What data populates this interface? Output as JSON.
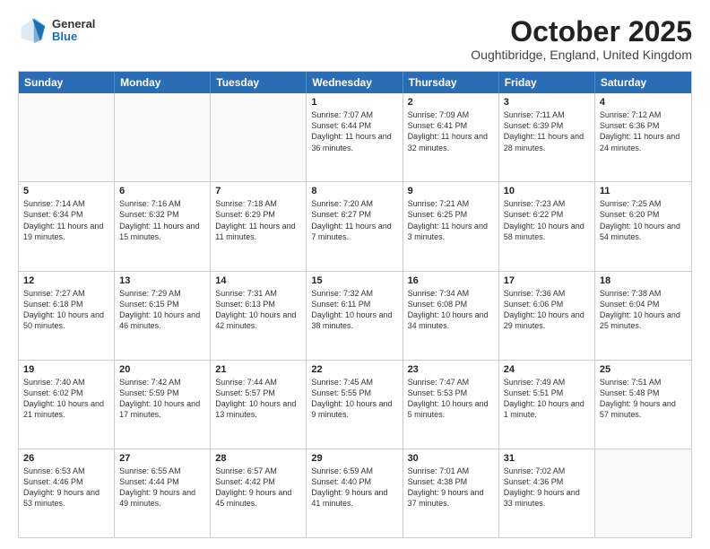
{
  "header": {
    "logo_general": "General",
    "logo_blue": "Blue",
    "month_year": "October 2025",
    "location": "Oughtibridge, England, United Kingdom"
  },
  "days_of_week": [
    "Sunday",
    "Monday",
    "Tuesday",
    "Wednesday",
    "Thursday",
    "Friday",
    "Saturday"
  ],
  "rows": [
    [
      {
        "day": "",
        "sunrise": "",
        "sunset": "",
        "daylight": ""
      },
      {
        "day": "",
        "sunrise": "",
        "sunset": "",
        "daylight": ""
      },
      {
        "day": "",
        "sunrise": "",
        "sunset": "",
        "daylight": ""
      },
      {
        "day": "1",
        "sunrise": "Sunrise: 7:07 AM",
        "sunset": "Sunset: 6:44 PM",
        "daylight": "Daylight: 11 hours and 36 minutes."
      },
      {
        "day": "2",
        "sunrise": "Sunrise: 7:09 AM",
        "sunset": "Sunset: 6:41 PM",
        "daylight": "Daylight: 11 hours and 32 minutes."
      },
      {
        "day": "3",
        "sunrise": "Sunrise: 7:11 AM",
        "sunset": "Sunset: 6:39 PM",
        "daylight": "Daylight: 11 hours and 28 minutes."
      },
      {
        "day": "4",
        "sunrise": "Sunrise: 7:12 AM",
        "sunset": "Sunset: 6:36 PM",
        "daylight": "Daylight: 11 hours and 24 minutes."
      }
    ],
    [
      {
        "day": "5",
        "sunrise": "Sunrise: 7:14 AM",
        "sunset": "Sunset: 6:34 PM",
        "daylight": "Daylight: 11 hours and 19 minutes."
      },
      {
        "day": "6",
        "sunrise": "Sunrise: 7:16 AM",
        "sunset": "Sunset: 6:32 PM",
        "daylight": "Daylight: 11 hours and 15 minutes."
      },
      {
        "day": "7",
        "sunrise": "Sunrise: 7:18 AM",
        "sunset": "Sunset: 6:29 PM",
        "daylight": "Daylight: 11 hours and 11 minutes."
      },
      {
        "day": "8",
        "sunrise": "Sunrise: 7:20 AM",
        "sunset": "Sunset: 6:27 PM",
        "daylight": "Daylight: 11 hours and 7 minutes."
      },
      {
        "day": "9",
        "sunrise": "Sunrise: 7:21 AM",
        "sunset": "Sunset: 6:25 PM",
        "daylight": "Daylight: 11 hours and 3 minutes."
      },
      {
        "day": "10",
        "sunrise": "Sunrise: 7:23 AM",
        "sunset": "Sunset: 6:22 PM",
        "daylight": "Daylight: 10 hours and 58 minutes."
      },
      {
        "day": "11",
        "sunrise": "Sunrise: 7:25 AM",
        "sunset": "Sunset: 6:20 PM",
        "daylight": "Daylight: 10 hours and 54 minutes."
      }
    ],
    [
      {
        "day": "12",
        "sunrise": "Sunrise: 7:27 AM",
        "sunset": "Sunset: 6:18 PM",
        "daylight": "Daylight: 10 hours and 50 minutes."
      },
      {
        "day": "13",
        "sunrise": "Sunrise: 7:29 AM",
        "sunset": "Sunset: 6:15 PM",
        "daylight": "Daylight: 10 hours and 46 minutes."
      },
      {
        "day": "14",
        "sunrise": "Sunrise: 7:31 AM",
        "sunset": "Sunset: 6:13 PM",
        "daylight": "Daylight: 10 hours and 42 minutes."
      },
      {
        "day": "15",
        "sunrise": "Sunrise: 7:32 AM",
        "sunset": "Sunset: 6:11 PM",
        "daylight": "Daylight: 10 hours and 38 minutes."
      },
      {
        "day": "16",
        "sunrise": "Sunrise: 7:34 AM",
        "sunset": "Sunset: 6:08 PM",
        "daylight": "Daylight: 10 hours and 34 minutes."
      },
      {
        "day": "17",
        "sunrise": "Sunrise: 7:36 AM",
        "sunset": "Sunset: 6:06 PM",
        "daylight": "Daylight: 10 hours and 29 minutes."
      },
      {
        "day": "18",
        "sunrise": "Sunrise: 7:38 AM",
        "sunset": "Sunset: 6:04 PM",
        "daylight": "Daylight: 10 hours and 25 minutes."
      }
    ],
    [
      {
        "day": "19",
        "sunrise": "Sunrise: 7:40 AM",
        "sunset": "Sunset: 6:02 PM",
        "daylight": "Daylight: 10 hours and 21 minutes."
      },
      {
        "day": "20",
        "sunrise": "Sunrise: 7:42 AM",
        "sunset": "Sunset: 5:59 PM",
        "daylight": "Daylight: 10 hours and 17 minutes."
      },
      {
        "day": "21",
        "sunrise": "Sunrise: 7:44 AM",
        "sunset": "Sunset: 5:57 PM",
        "daylight": "Daylight: 10 hours and 13 minutes."
      },
      {
        "day": "22",
        "sunrise": "Sunrise: 7:45 AM",
        "sunset": "Sunset: 5:55 PM",
        "daylight": "Daylight: 10 hours and 9 minutes."
      },
      {
        "day": "23",
        "sunrise": "Sunrise: 7:47 AM",
        "sunset": "Sunset: 5:53 PM",
        "daylight": "Daylight: 10 hours and 5 minutes."
      },
      {
        "day": "24",
        "sunrise": "Sunrise: 7:49 AM",
        "sunset": "Sunset: 5:51 PM",
        "daylight": "Daylight: 10 hours and 1 minute."
      },
      {
        "day": "25",
        "sunrise": "Sunrise: 7:51 AM",
        "sunset": "Sunset: 5:48 PM",
        "daylight": "Daylight: 9 hours and 57 minutes."
      }
    ],
    [
      {
        "day": "26",
        "sunrise": "Sunrise: 6:53 AM",
        "sunset": "Sunset: 4:46 PM",
        "daylight": "Daylight: 9 hours and 53 minutes."
      },
      {
        "day": "27",
        "sunrise": "Sunrise: 6:55 AM",
        "sunset": "Sunset: 4:44 PM",
        "daylight": "Daylight: 9 hours and 49 minutes."
      },
      {
        "day": "28",
        "sunrise": "Sunrise: 6:57 AM",
        "sunset": "Sunset: 4:42 PM",
        "daylight": "Daylight: 9 hours and 45 minutes."
      },
      {
        "day": "29",
        "sunrise": "Sunrise: 6:59 AM",
        "sunset": "Sunset: 4:40 PM",
        "daylight": "Daylight: 9 hours and 41 minutes."
      },
      {
        "day": "30",
        "sunrise": "Sunrise: 7:01 AM",
        "sunset": "Sunset: 4:38 PM",
        "daylight": "Daylight: 9 hours and 37 minutes."
      },
      {
        "day": "31",
        "sunrise": "Sunrise: 7:02 AM",
        "sunset": "Sunset: 4:36 PM",
        "daylight": "Daylight: 9 hours and 33 minutes."
      },
      {
        "day": "",
        "sunrise": "",
        "sunset": "",
        "daylight": ""
      }
    ]
  ]
}
